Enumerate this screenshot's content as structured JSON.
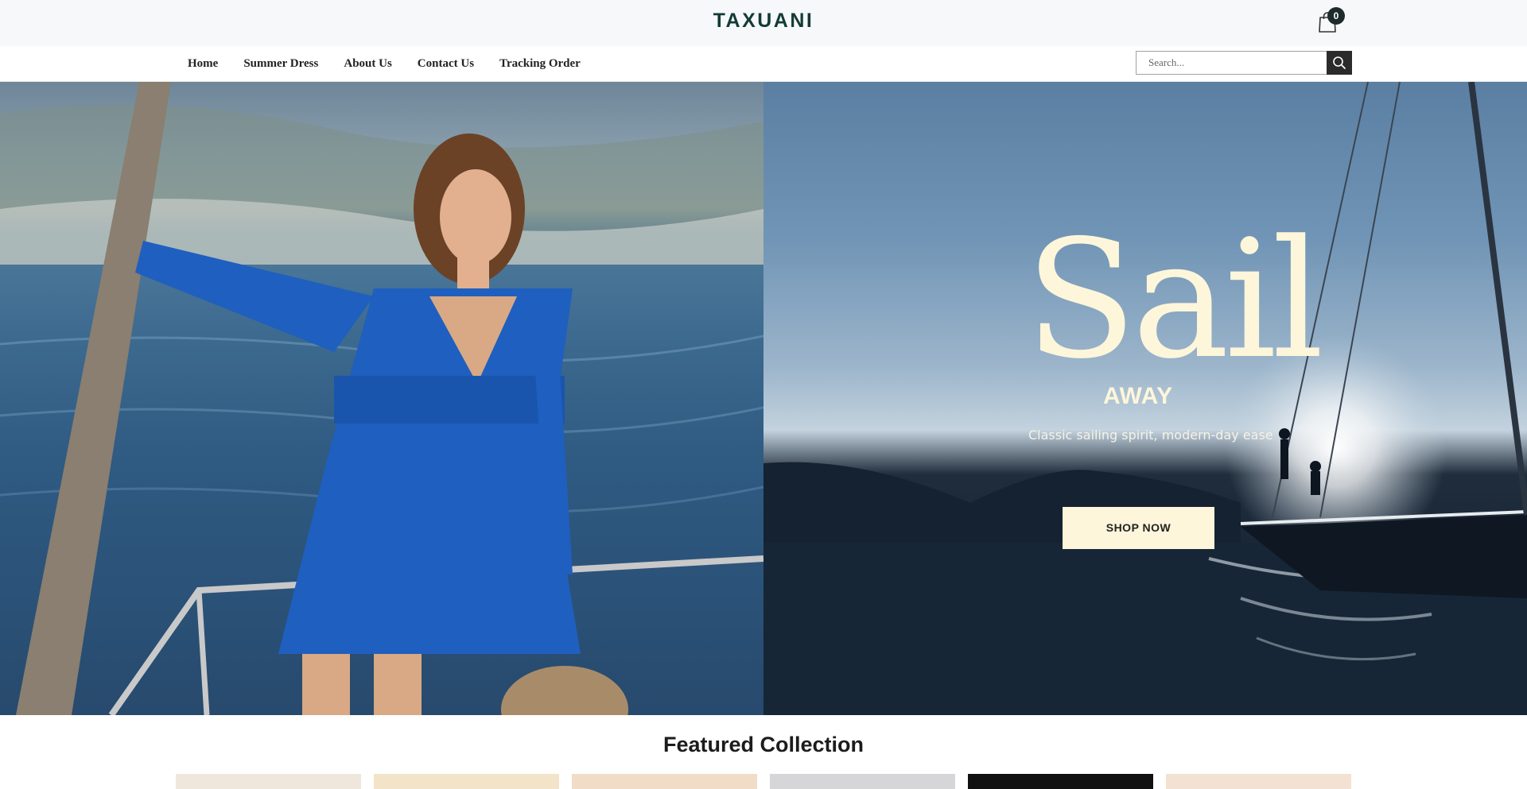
{
  "brand": {
    "logo_text": "TAXUANI"
  },
  "cart": {
    "count": "0",
    "icon": "shopping-bag-icon"
  },
  "nav": {
    "items": [
      {
        "label": "Home"
      },
      {
        "label": "Summer Dress"
      },
      {
        "label": "About Us"
      },
      {
        "label": "Contact Us"
      },
      {
        "label": "Tracking Order"
      }
    ]
  },
  "search": {
    "placeholder": "Search...",
    "value": "",
    "icon": "search-icon"
  },
  "hero": {
    "headline": "Sail",
    "subheadline": "AWAY",
    "tagline": "Classic sailing spirit, modern-day ease",
    "cta_label": "SHOP NOW",
    "left_image": "woman-in-blue-dress-on-sailboat",
    "right_image": "sailboat-at-sunset",
    "colors": {
      "headline": "#fdf6da",
      "cta_bg": "#fdf6da"
    }
  },
  "featured": {
    "title": "Featured Collection",
    "thumb_colors": [
      "#efe6dc",
      "#f3e3c8",
      "#f1dcc8",
      "#d6d6d8",
      "#111111",
      "#f3e2d3"
    ]
  }
}
